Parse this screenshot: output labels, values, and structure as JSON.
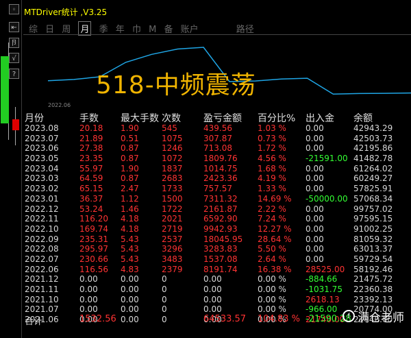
{
  "window": {
    "title": "MTDriver统计 ,V3.25"
  },
  "toolbar": {
    "buttons": [
      "◦",
      "⇤",
      "卪",
      "√",
      "?"
    ]
  },
  "menu": {
    "items": [
      "综",
      "日",
      "周",
      "月",
      "季",
      "年",
      "巾",
      "M",
      "备",
      "账户"
    ],
    "active_index": 3,
    "extra": "路径"
  },
  "chart": {
    "year_label": "2022.06",
    "overlay_text": "518-中频震荡",
    "line_color": "#1fa6e6",
    "equity_values": [
      42943.29,
      42503.73,
      42195.86,
      41482.78,
      61264.02,
      60249.27,
      57825.91,
      57068.34,
      99757.02,
      97595.15,
      91002.25,
      81059.32,
      63013.37,
      59729.54,
      58192.46
    ]
  },
  "table": {
    "headers": [
      "月份",
      "手数",
      "最大手数",
      "次数",
      "盈亏金额",
      "百分比%",
      "出入金",
      "余额"
    ],
    "rows": [
      [
        "2023.08",
        "20.18",
        "1.90",
        "545",
        "439.56",
        "1.03 %",
        "0.00",
        "42943.29"
      ],
      [
        "2023.07",
        "21.89",
        "0.51",
        "1075",
        "307.87",
        "0.73 %",
        "0.00",
        "42503.73"
      ],
      [
        "2023.06",
        "27.38",
        "0.87",
        "1246",
        "713.08",
        "1.72 %",
        "0.00",
        "42195.86"
      ],
      [
        "2023.05",
        "23.35",
        "0.87",
        "1072",
        "1809.76",
        "4.56 %",
        "-21591.00",
        "41482.78"
      ],
      [
        "2023.04",
        "55.97",
        "1.90",
        "1837",
        "1014.75",
        "1.68 %",
        "0.00",
        "61264.02"
      ],
      [
        "2023.03",
        "64.59",
        "0.87",
        "2683",
        "2423.36",
        "4.19 %",
        "0.00",
        "60249.27"
      ],
      [
        "2023.02",
        "65.15",
        "2.47",
        "1733",
        "757.57",
        "1.33 %",
        "0.00",
        "57825.91"
      ],
      [
        "2023.01",
        "36.37",
        "1.12",
        "1500",
        "7311.32",
        "14.69 %",
        "-50000.00",
        "57068.34"
      ],
      [
        "2022.12",
        "53.24",
        "1.46",
        "1722",
        "2161.87",
        "2.22 %",
        "0.00",
        "99757.02"
      ],
      [
        "2022.11",
        "116.20",
        "4.18",
        "2021",
        "6592.90",
        "7.24 %",
        "0.00",
        "97595.15"
      ],
      [
        "2022.10",
        "169.74",
        "4.18",
        "2719",
        "9942.93",
        "12.27 %",
        "0.00",
        "91002.25"
      ],
      [
        "2022.09",
        "235.31",
        "5.43",
        "2537",
        "18045.95",
        "28.64 %",
        "0.00",
        "81059.32"
      ],
      [
        "2022.08",
        "295.97",
        "5.43",
        "3296",
        "3283.83",
        "5.50 %",
        "0.00",
        "63013.37"
      ],
      [
        "2022.07",
        "230.66",
        "5.43",
        "3483",
        "1537.08",
        "2.64 %",
        "0.00",
        "59729.54"
      ],
      [
        "2022.06",
        "116.56",
        "4.83",
        "2379",
        "8191.74",
        "16.38 %",
        "28525.00",
        "58192.46"
      ],
      [
        "2021.12",
        "0.00",
        "0.00",
        "0",
        "0.00",
        "0.00 %",
        "-884.66",
        "21475.72"
      ],
      [
        "2021.11",
        "0.00",
        "0.00",
        "0",
        "0.00",
        "0.00 %",
        "-1031.75",
        "22360.38"
      ],
      [
        "2021.10",
        "0.00",
        "0.00",
        "0",
        "0.00",
        "0.00 %",
        "2618.13",
        "23392.13"
      ],
      [
        "2021.07",
        "0.00",
        "0.00",
        "0",
        "0.00",
        "0.00 %",
        "-966.00",
        "20774.00"
      ],
      [
        "2021.06",
        "0.00",
        "0.00",
        "0",
        "0.00",
        "0.00 %",
        "21740.00",
        "21740.00"
      ]
    ],
    "total": {
      "label": "合计",
      "lots": "1532.56",
      "profit": "64533.57",
      "percent": "104.83 %",
      "deposit": "-21590.28"
    }
  },
  "watermark": {
    "text": "满仓老师",
    "logo": "f"
  },
  "colors": {
    "title": "#ffff00",
    "positive": "#ff3333",
    "negative": "#33ff33",
    "neutral": "#d8d8d8",
    "overlay": "#f0b400"
  }
}
